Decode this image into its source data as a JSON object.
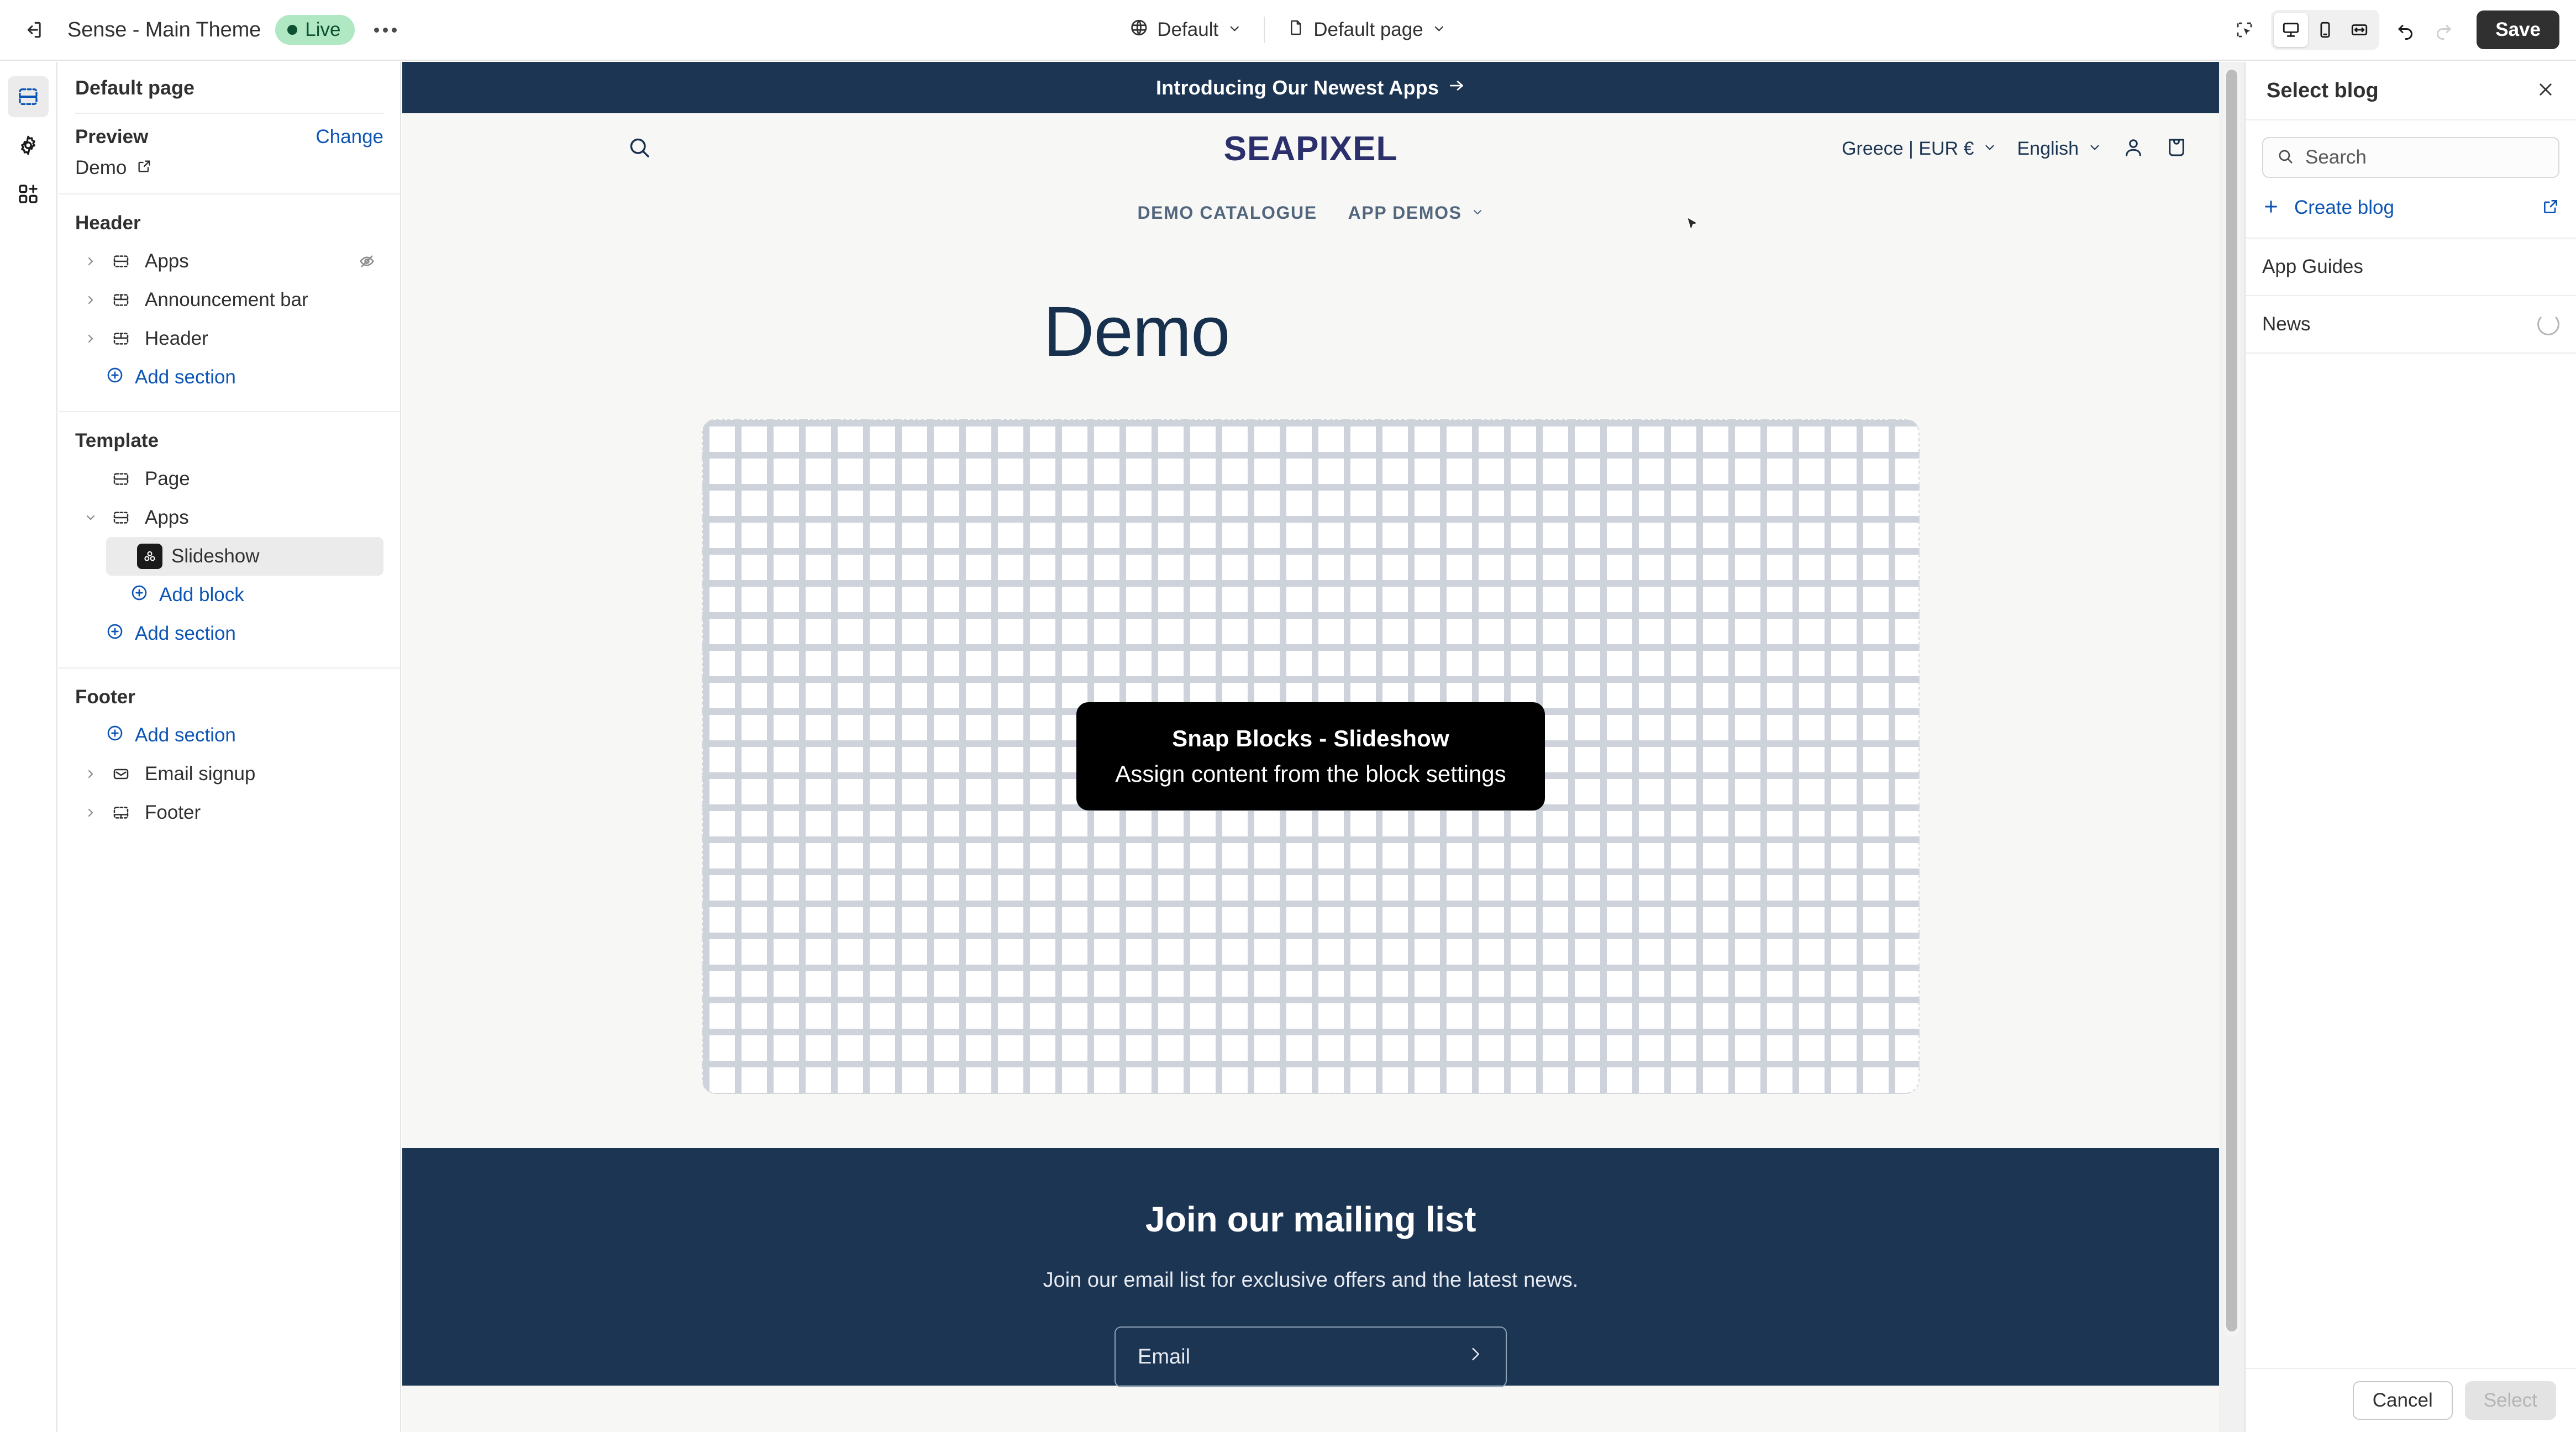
{
  "topbar": {
    "exit_icon": "exit-icon",
    "theme_name": "Sense - Main Theme",
    "status_badge": "Live",
    "more_icon": "more-horizontal-icon",
    "locale_selector": {
      "icon": "globe-icon",
      "label": "Default",
      "caret": "chevron-down-icon"
    },
    "page_selector": {
      "icon": "page-icon",
      "label": "Default page",
      "caret": "chevron-down-icon"
    },
    "inspector_icon": "select-region-icon",
    "devices": [
      {
        "name": "desktop-icon",
        "active": true
      },
      {
        "name": "mobile-icon",
        "active": false
      },
      {
        "name": "fullwidth-icon",
        "active": false
      }
    ],
    "undo_icon": "undo-icon",
    "redo_icon": "redo-icon",
    "save_label": "Save"
  },
  "rail": {
    "items": [
      {
        "name": "sections-icon",
        "active": true
      },
      {
        "name": "gear-icon",
        "active": false
      },
      {
        "name": "app-embeds-icon",
        "active": false
      }
    ]
  },
  "sidebar": {
    "page_title": "Default page",
    "preview": {
      "label": "Preview",
      "change_label": "Change",
      "value": "Demo",
      "external_icon": "external-link-icon"
    },
    "groups": [
      {
        "title": "Header",
        "rows": [
          {
            "label": "Apps",
            "icon": "section-apps-icon",
            "caret": "chevron-right-icon",
            "hidden_icon": "eye-off-icon",
            "selected": false
          },
          {
            "label": "Announcement bar",
            "icon": "section-icon",
            "caret": "chevron-right-icon",
            "selected": false
          },
          {
            "label": "Header",
            "icon": "section-icon",
            "caret": "chevron-right-icon",
            "selected": false
          }
        ],
        "add_label": "Add section"
      },
      {
        "title": "Template",
        "rows": [
          {
            "label": "Page",
            "icon": "section-apps-icon",
            "caret": "none",
            "selected": false
          },
          {
            "label": "Apps",
            "icon": "section-apps-icon",
            "caret": "chevron-down-icon",
            "selected": false
          }
        ],
        "child": {
          "label": "Slideshow",
          "icon": "app-block-icon",
          "selected": true
        },
        "add_block_label": "Add block",
        "add_label": "Add section"
      },
      {
        "title": "Footer",
        "add_label": "Add section",
        "rows": [
          {
            "label": "Email signup",
            "icon": "mail-icon",
            "caret": "chevron-right-icon",
            "selected": false
          },
          {
            "label": "Footer",
            "icon": "section-footer-icon",
            "caret": "chevron-right-icon",
            "selected": false
          }
        ]
      }
    ]
  },
  "preview": {
    "announcement": {
      "text": "Introducing Our Newest Apps",
      "arrow": "arrow-right-icon"
    },
    "store": {
      "search_icon": "search-icon",
      "logo": "SEAPIXEL",
      "logo_mark": "sailboat-icon",
      "country_currency": "Greece | EUR €",
      "language": "English",
      "account_icon": "user-icon",
      "cart_icon": "shopping-bag-icon",
      "nav": [
        {
          "label": "DEMO CATALOGUE",
          "has_caret": false
        },
        {
          "label": "APP DEMOS",
          "has_caret": true
        }
      ]
    },
    "page_heading": "Demo",
    "placeholder": {
      "title": "Snap Blocks - Slideshow",
      "subtitle": "Assign content from the block settings"
    },
    "mailing": {
      "heading": "Join our mailing list",
      "body": "Join our email list for exclusive offers and the latest news.",
      "field_placeholder": "Email",
      "submit_icon": "arrow-right-icon"
    },
    "scrollbar": "vertical-scrollbar"
  },
  "right_panel": {
    "title": "Select blog",
    "close_icon": "close-icon",
    "search": {
      "placeholder": "Search",
      "value": "",
      "icon": "search-icon"
    },
    "create": {
      "plus_icon": "plus-icon",
      "label": "Create blog",
      "external_icon": "external-link-icon"
    },
    "items": [
      {
        "label": "App Guides",
        "loading": false
      },
      {
        "label": "News",
        "loading": true
      }
    ],
    "footer": {
      "cancel_label": "Cancel",
      "select_label": "Select"
    }
  },
  "colors": {
    "accent_blue": "#0d55b5",
    "navy": "#1c3553",
    "logo_navy": "#2b2f6b",
    "live_bg": "#afe8c2",
    "live_fg": "#0c5132",
    "save_bg": "#303030"
  }
}
